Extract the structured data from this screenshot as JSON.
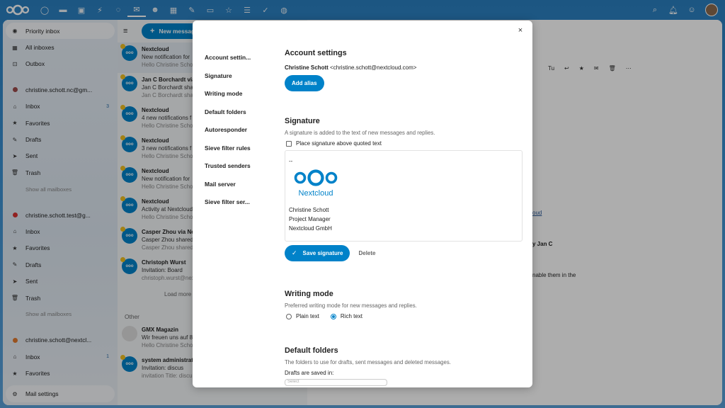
{
  "topbar": {
    "app_icons": [
      "dashboard-icon",
      "files-icon",
      "photos-icon",
      "activity-icon",
      "talk-icon",
      "mail-icon",
      "contacts-icon",
      "calendar-icon",
      "notes-icon",
      "deck-icon",
      "favorites-icon",
      "tasks-icon",
      "checkmark-icon",
      "maps-icon"
    ],
    "active_app": "mail-icon",
    "right_icons": [
      "search-icon",
      "notifications-icon",
      "contacts-menu-icon"
    ]
  },
  "sidebar": {
    "items": [
      {
        "label": "Priority inbox",
        "icon": "◉",
        "active": true
      },
      {
        "label": "All inboxes",
        "icon": "▦"
      },
      {
        "label": "Outbox",
        "icon": "⊡"
      }
    ],
    "accounts": [
      {
        "name": "christine.schott.nc@gm...",
        "color": "#9c4a4a",
        "items": [
          {
            "label": "Inbox",
            "icon": "⌂",
            "count": "3"
          },
          {
            "label": "Favorites",
            "icon": "★"
          },
          {
            "label": "Drafts",
            "icon": "✎"
          },
          {
            "label": "Sent",
            "icon": "➤"
          },
          {
            "label": "Trash",
            "icon": "🗑"
          }
        ],
        "show_all": "Show all mailboxes"
      },
      {
        "name": "christine.schott.test@g...",
        "color": "#d63232",
        "items": [
          {
            "label": "Inbox",
            "icon": "⌂"
          },
          {
            "label": "Favorites",
            "icon": "★"
          },
          {
            "label": "Drafts",
            "icon": "✎"
          },
          {
            "label": "Sent",
            "icon": "➤"
          },
          {
            "label": "Trash",
            "icon": "🗑"
          }
        ],
        "show_all": "Show all mailboxes"
      },
      {
        "name": "christine.schott@nextcl...",
        "color": "#e07a2e",
        "items": [
          {
            "label": "Inbox",
            "icon": "⌂",
            "count": "1"
          },
          {
            "label": "Favorites",
            "icon": "★"
          }
        ]
      }
    ],
    "settings": "Mail settings"
  },
  "list": {
    "new_message": "New message",
    "messages": [
      {
        "from": "Nextcloud",
        "subject": "New notification for",
        "preview": "Hello Christine Schott",
        "selected": true
      },
      {
        "from": "Jan C Borchardt via",
        "subject": "Jan C Borchardt sha",
        "preview": "Jan C Borchardt shared"
      },
      {
        "from": "Nextcloud",
        "subject": "4 new notifications f",
        "preview": "Hello Christine Scho"
      },
      {
        "from": "Nextcloud",
        "subject": "3 new notifications f",
        "preview": "Hello Christine Scho"
      },
      {
        "from": "Nextcloud",
        "subject": "New notification for",
        "preview": "Hello Christine Scho"
      },
      {
        "from": "Nextcloud",
        "subject": "Activity at Nextcloud",
        "preview": "Hello Christine Scho"
      },
      {
        "from": "Casper Zhou via Ne",
        "subject": "Casper Zhou shared",
        "preview": "Casper Zhou shared"
      },
      {
        "from": "Christoph Wurst",
        "subject": "Invitation: Board",
        "preview": "christoph.wurst@nex"
      }
    ],
    "load_more": "Load more",
    "other_label": "Other",
    "other_messages": [
      {
        "from": "GMX Magazin",
        "subject": "Wir freuen uns auf 8",
        "preview": "Hello Christine Scho"
      },
      {
        "from": "system administrat",
        "subject": "Invitation: discus",
        "preview": "invitation  Title: discuss the proj..."
      }
    ]
  },
  "detail": {
    "toolbar": [
      "Tu",
      "↩",
      "★",
      "✉",
      "🗑",
      "⋯"
    ],
    "fragments": [
      "oud",
      "y Jan C",
      "nable them in the"
    ]
  },
  "modal": {
    "close": "×",
    "nav": [
      "Account settin...",
      "Signature",
      "Writing mode",
      "Default folders",
      "Autoresponder",
      "Sieve filter rules",
      "Trusted senders",
      "Mail server",
      "Sieve filter ser..."
    ],
    "account": {
      "title": "Account settings",
      "name": "Christine Schott",
      "email": "<christine.schott@nextcloud.com>",
      "add_alias": "Add alias"
    },
    "signature": {
      "title": "Signature",
      "desc": "A signature is added to the text of new messages and replies.",
      "checkbox_label": "Place signature above quoted text",
      "dashes": "--",
      "logo_text": "Nextcloud",
      "lines": [
        "Christine Schott",
        "Project Manager",
        "Nextcloud GmbH"
      ],
      "save": "Save signature",
      "delete": "Delete"
    },
    "writing_mode": {
      "title": "Writing mode",
      "desc": "Preferred writing mode for new messages and replies.",
      "plain": "Plain text",
      "rich": "Rich text",
      "selected": "rich"
    },
    "default_folders": {
      "title": "Default folders",
      "desc": "The folders to use for drafts, sent messages and deleted messages.",
      "drafts_label": "Drafts are saved in:",
      "select_placeholder": "Select"
    }
  }
}
